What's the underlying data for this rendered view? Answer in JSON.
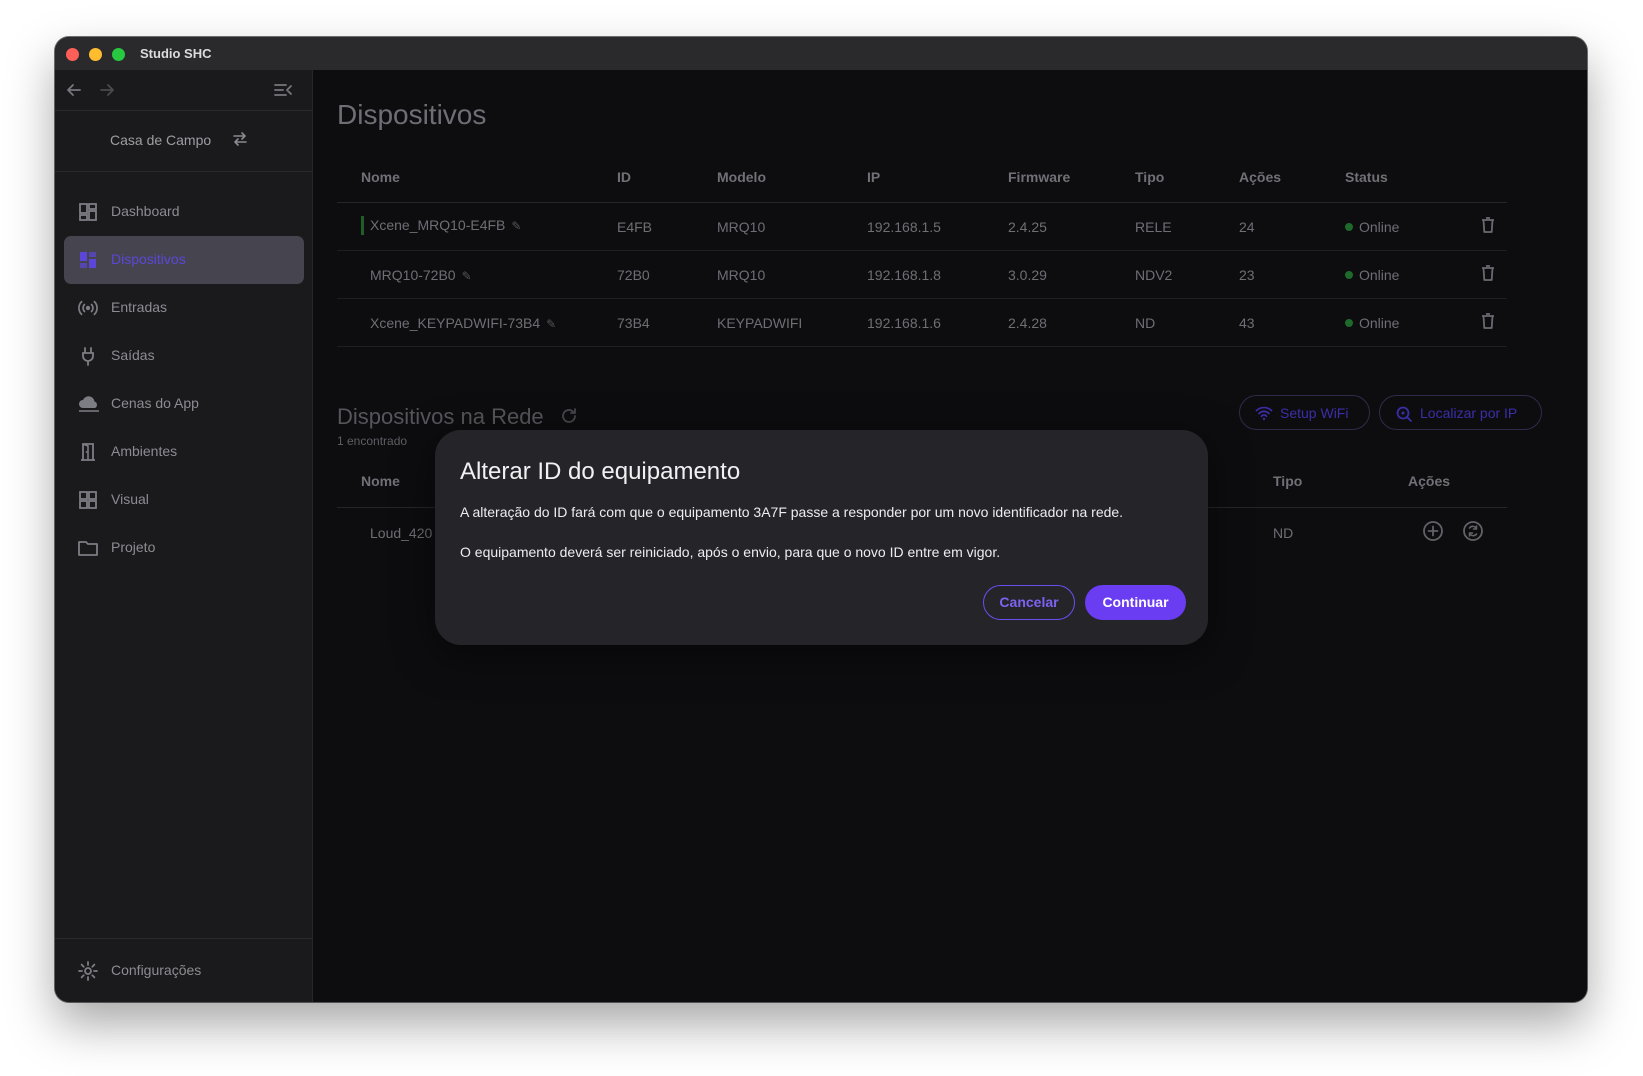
{
  "window": {
    "title": "Studio SHC"
  },
  "sidebar": {
    "project_name": "Casa de Campo",
    "items": [
      {
        "label": "Dashboard",
        "icon": "dashboard-grid-icon"
      },
      {
        "label": "Dispositivos",
        "icon": "devices-grid-icon",
        "active": true
      },
      {
        "label": "Entradas",
        "icon": "broadcast-icon"
      },
      {
        "label": "Saídas",
        "icon": "plug-icon"
      },
      {
        "label": "Cenas do App",
        "icon": "cloud-icon"
      },
      {
        "label": "Ambientes",
        "icon": "door-icon"
      },
      {
        "label": "Visual",
        "icon": "grid-icon"
      },
      {
        "label": "Projeto",
        "icon": "folder-icon"
      }
    ],
    "settings_label": "Configurações"
  },
  "page": {
    "title": "Dispositivos"
  },
  "devices_table": {
    "headers": [
      "Nome",
      "ID",
      "Modelo",
      "IP",
      "Firmware",
      "Tipo",
      "Ações",
      "Status"
    ],
    "rows": [
      {
        "name": "Xcene_MRQ10-E4FB",
        "id": "E4FB",
        "model": "MRQ10",
        "ip": "192.168.1.5",
        "firmware": "2.4.25",
        "type": "RELE",
        "actions": "24",
        "status": "Online"
      },
      {
        "name": "MRQ10-72B0",
        "id": "72B0",
        "model": "MRQ10",
        "ip": "192.168.1.8",
        "firmware": "3.0.29",
        "type": "NDV2",
        "actions": "23",
        "status": "Online"
      },
      {
        "name": "Xcene_KEYPADWIFI-73B4",
        "id": "73B4",
        "model": "KEYPADWIFI",
        "ip": "192.168.1.6",
        "firmware": "2.4.28",
        "type": "ND",
        "actions": "43",
        "status": "Online"
      }
    ]
  },
  "network_section": {
    "title": "Dispositivos na Rede",
    "count": "1 encontrado",
    "setup_wifi_label": "Setup WiFi",
    "find_by_ip_label": "Localizar por IP",
    "headers": {
      "name": "Nome",
      "type": "Tipo",
      "actions": "Ações"
    },
    "row": {
      "name": "Loud_420",
      "type": "ND"
    }
  },
  "modal": {
    "title": "Alterar ID do equipamento",
    "paragraph1": "A alteração do ID fará com que o equipamento 3A7F passe a responder por um novo identificador na rede.",
    "paragraph2": "O equipamento deverá ser reiniciado, após o envio, para que o novo ID entre em vigor.",
    "cancel_label": "Cancelar",
    "continue_label": "Continuar"
  },
  "colors": {
    "accent": "#6a3cf2",
    "online": "#1e6a2a",
    "modal_bg": "#252429",
    "app_bg": "#0d0d10"
  }
}
